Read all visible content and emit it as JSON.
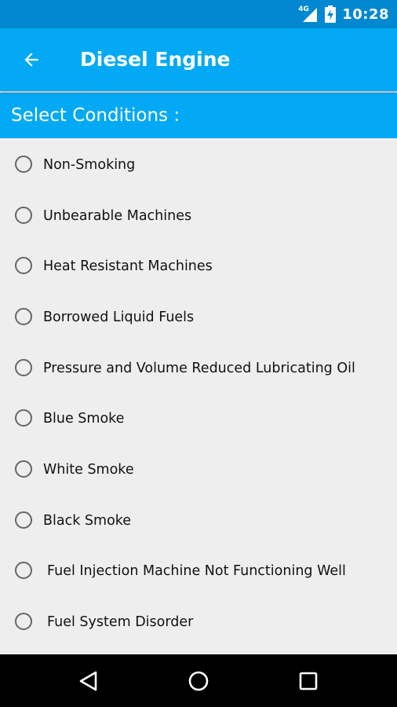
{
  "status_bar": {
    "network": "4G",
    "time": "10:28",
    "icons": [
      "signal-icon",
      "battery-charging-icon"
    ]
  },
  "app_bar": {
    "title": "Diesel Engine",
    "back_icon": "arrow-back-icon"
  },
  "section": {
    "title": "Select Conditions :"
  },
  "conditions": [
    {
      "label": "Non-Smoking",
      "selected": false
    },
    {
      "label": "Unbearable Machines",
      "selected": false
    },
    {
      "label": "Heat Resistant Machines",
      "selected": false
    },
    {
      "label": "Borrowed Liquid Fuels",
      "selected": false
    },
    {
      "label": "Pressure and Volume Reduced Lubricating Oil",
      "selected": false
    },
    {
      "label": "Blue Smoke",
      "selected": false
    },
    {
      "label": "White Smoke",
      "selected": false
    },
    {
      "label": "Black Smoke",
      "selected": false
    },
    {
      "label": "Fuel Injection Machine Not Functioning Well",
      "selected": false
    },
    {
      "label": "Fuel System Disorder",
      "selected": false
    }
  ],
  "nav_bar": {
    "icons": [
      "back-triangle-icon",
      "home-circle-icon",
      "recents-square-icon"
    ]
  },
  "colors": {
    "primary": "#03a9f4",
    "primary_dark": "#0288d1",
    "background": "#eeeeee",
    "nav_bar": "#000000"
  }
}
